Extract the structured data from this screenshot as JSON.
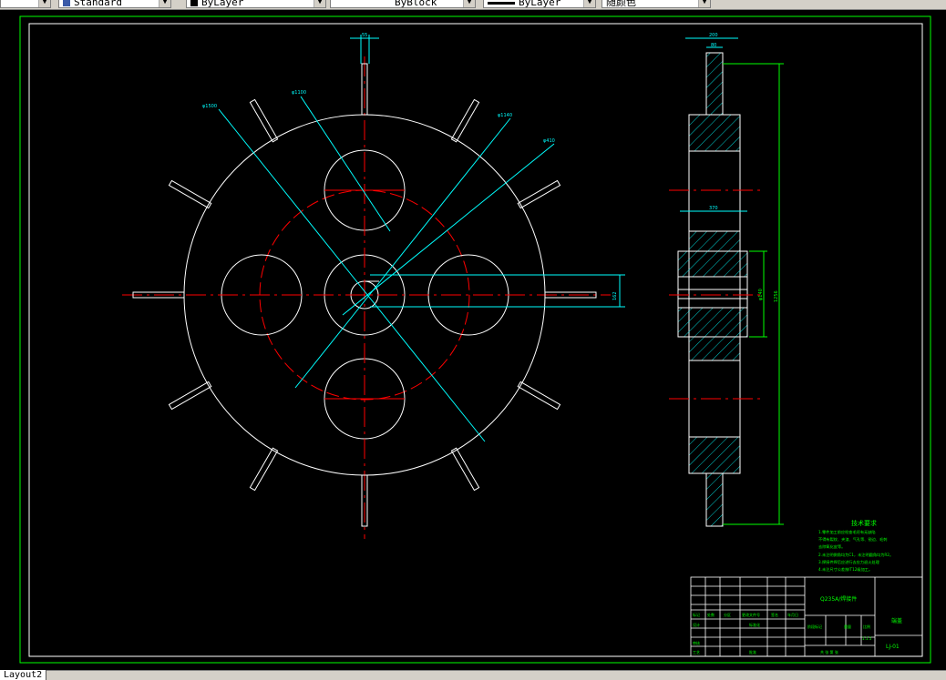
{
  "toolbar": {
    "text_style": "Standard",
    "layer": "ByLayer",
    "linetype": "ByBlock",
    "lineweight": "ByLayer",
    "plot_style": "随颜色"
  },
  "drawing": {
    "dims": {
      "width_55": "55",
      "d1500": "φ1500",
      "d1100": "φ1100",
      "d1140": "φ1140",
      "d410": "φ410",
      "keyway": "162",
      "side_top_outer": "200",
      "side_top_inner": "80",
      "side_mid": "370",
      "side_bore": "φ140",
      "side_total": "1256"
    },
    "notes": {
      "title": "技术要求",
      "lines": [
        "1.零件加工前应检查毛坯有无缺陷",
        "不得有裂纹、夹渣、气孔等、锐边、毛刺",
        "去除氧化皮等。",
        "2.未注明倒角均为C1，未注明圆角均为R2。",
        "3.焊接件焊后应进行去应力退火处理",
        "4.未注尺寸公差按IT12级加工。"
      ]
    },
    "title_block": {
      "material": "Q235A/焊接件",
      "part_name": "端盖",
      "drawing_no": "LJ-01",
      "stage_mark": "阶段标记",
      "weight": "重量",
      "scale_label": "比例",
      "scale_value": "1:1.5",
      "sheet_info": "共  张  第  张",
      "designer": "设计",
      "standardization": "标准化",
      "process": "工艺",
      "approve": "批准",
      "review": "审核",
      "mark": "标记",
      "count": "处数",
      "partition": "分区",
      "change_no": "更改文件号",
      "sign": "签名",
      "date": "年月日"
    }
  },
  "status": {
    "layout_tab": "Layout2"
  },
  "colors": {
    "outline": "#ffffff",
    "center_line": "#ff0000",
    "dimension": "#00ffff",
    "frame": "#00ff00",
    "hatch": "#00ffff",
    "notes": "#00ff00"
  }
}
